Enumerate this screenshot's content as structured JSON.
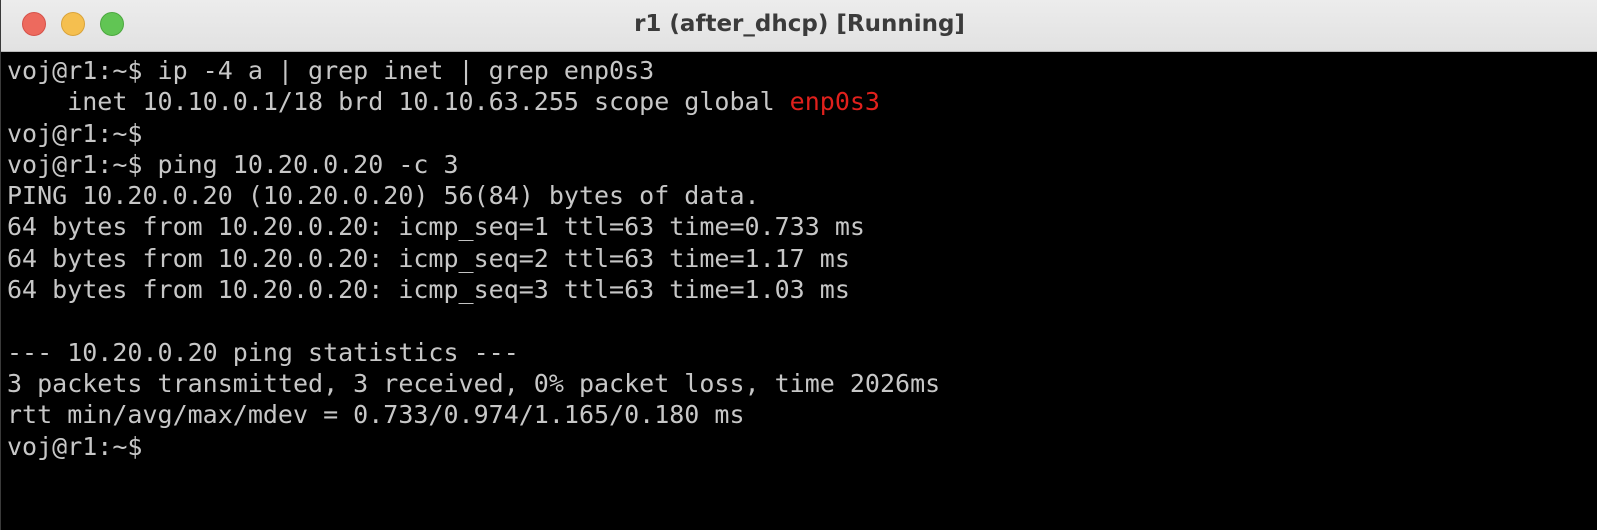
{
  "window": {
    "title": "r1 (after_dhcp) [Running]"
  },
  "terminal": {
    "lines": [
      {
        "text": "voj@r1:~$ ip -4 a | grep inet | grep enp0s3"
      },
      {
        "text": "    inet 10.10.0.1/18 brd 10.10.63.255 scope global ",
        "highlight": "enp0s3"
      },
      {
        "text": "voj@r1:~$"
      },
      {
        "text": "voj@r1:~$ ping 10.20.0.20 -c 3"
      },
      {
        "text": "PING 10.20.0.20 (10.20.0.20) 56(84) bytes of data."
      },
      {
        "text": "64 bytes from 10.20.0.20: icmp_seq=1 ttl=63 time=0.733 ms"
      },
      {
        "text": "64 bytes from 10.20.0.20: icmp_seq=2 ttl=63 time=1.17 ms"
      },
      {
        "text": "64 bytes from 10.20.0.20: icmp_seq=3 ttl=63 time=1.03 ms"
      },
      {
        "text": ""
      },
      {
        "text": "--- 10.20.0.20 ping statistics ---"
      },
      {
        "text": "3 packets transmitted, 3 received, 0% packet loss, time 2026ms"
      },
      {
        "text": "rtt min/avg/max/mdev = 0.733/0.974/1.165/0.180 ms"
      },
      {
        "text": "voj@r1:~$"
      }
    ],
    "colors": {
      "background": "#000000",
      "foreground": "#c7c7c7",
      "highlight": "#e0201c"
    }
  }
}
